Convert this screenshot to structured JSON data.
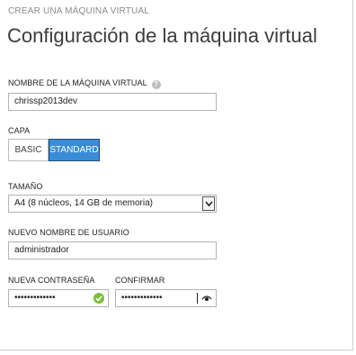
{
  "wizard": {
    "title": "CREAR UNA MÁQUINA VIRTUAL"
  },
  "page": {
    "title": "Configuración de la máquina virtual"
  },
  "vm_name": {
    "label": "NOMBRE DE LA MÁQUINA VIRTUAL",
    "value": "chrissp2013dev",
    "help_icon": "question-circle-icon"
  },
  "tier": {
    "label": "CAPA",
    "options": [
      "BASIC",
      "STANDARD"
    ],
    "selected": "STANDARD"
  },
  "size": {
    "label": "TAMAÑO",
    "value": "A4 (8 núcleos, 14 GB de memoria)"
  },
  "username": {
    "label": "NUEVO NOMBRE DE USUARIO",
    "value": "administrador"
  },
  "password": {
    "label": "NUEVA CONTRASEÑA",
    "value": "•••••••••••••",
    "status_icon": "check-circle-icon"
  },
  "confirm": {
    "label": "CONFIRMAR",
    "value": "•••••••••••••",
    "reveal_icon": "eye-icon"
  },
  "colors": {
    "accent": "#3b8cd6",
    "valid": "#7bbf3a",
    "border": "#b3b3b3"
  }
}
